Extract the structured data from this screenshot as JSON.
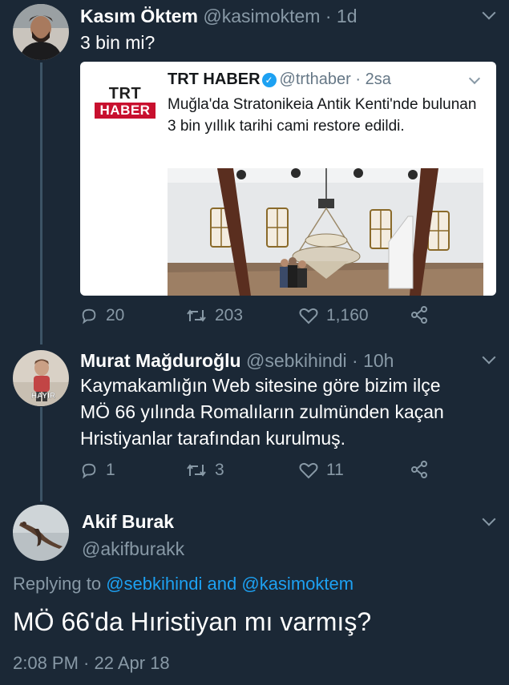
{
  "tweet1": {
    "name": "Kasım Öktem",
    "handle": "@kasimoktem",
    "time": "1d",
    "text": "3 bin mi?",
    "quote": {
      "logo_top": "TRT",
      "logo_bottom": "HABER",
      "name": "TRT HABER",
      "handle": "@trthaber",
      "time": "2sa",
      "text": "Muğla'da Stratonikeia Antik Kenti'nde bulunan 3 bin yıllık tarihi cami restore edildi."
    },
    "replies": "20",
    "retweets": "203",
    "likes": "1,160"
  },
  "tweet2": {
    "name": "Murat Mağduroğlu",
    "handle": "@sebkihindi",
    "time": "10h",
    "avatar_label": "HAYIR",
    "text_lines": [
      "Kaymakamlığın Web sitesine göre bizim ilçe",
      "MÖ 66 yılında Romalıların zulmünden kaçan",
      "Hristiyanlar tarafından kurulmuş."
    ],
    "replies": "1",
    "retweets": "3",
    "likes": "11"
  },
  "tweet3": {
    "name": "Akif Burak",
    "handle": "@akifburakk",
    "replying_prefix": "Replying to",
    "reply_user1": "@sebkihindi",
    "reply_and": "and",
    "reply_user2": "@kasimoktem",
    "text": "MÖ 66'da Hıristiyan mı varmış?",
    "timestamp": "2:08 PM · 22 Apr 18"
  },
  "colors": {
    "background": "#1b2836",
    "accent": "#1da1f2",
    "muted": "#8899a6",
    "thread_line": "#3d5466"
  }
}
